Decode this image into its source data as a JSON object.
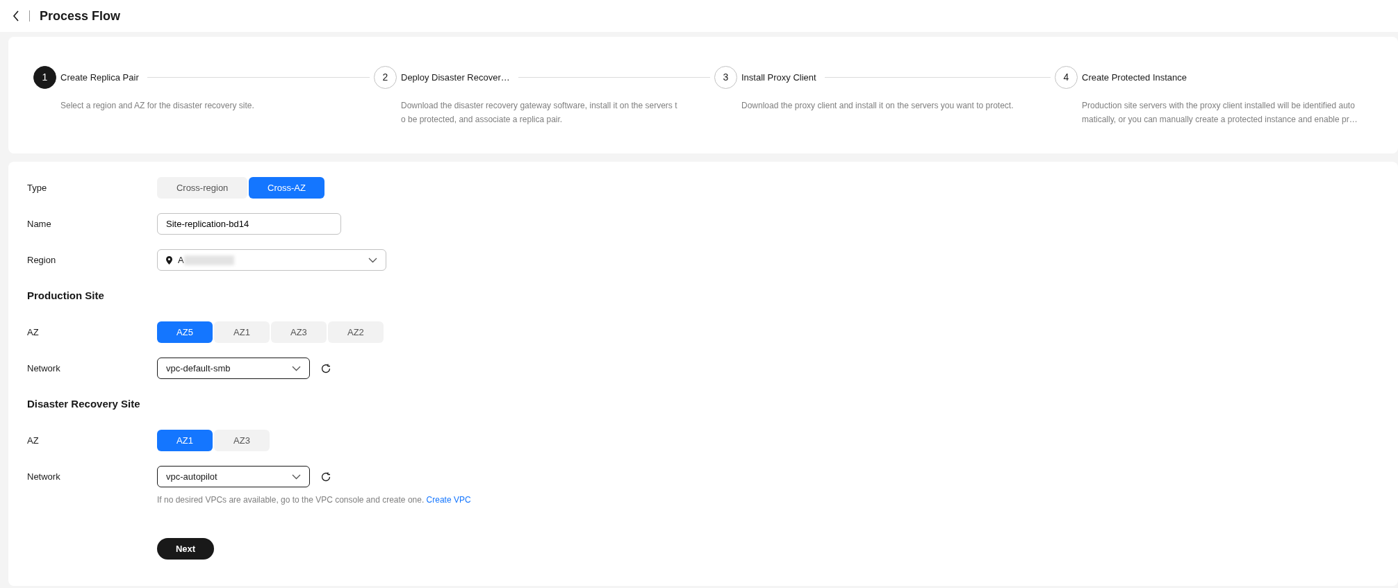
{
  "header": {
    "title": "Process Flow"
  },
  "steps": [
    {
      "number": "1",
      "title": "Create Replica Pair",
      "active": true,
      "description": [
        "Select a region and AZ for the disaster recovery site."
      ]
    },
    {
      "number": "2",
      "title": "Deploy Disaster Recover…",
      "active": false,
      "description": [
        "Download the disaster recovery gateway software, install it on the servers t",
        "o be protected, and associate a replica pair."
      ]
    },
    {
      "number": "3",
      "title": "Install Proxy Client",
      "active": false,
      "description": [
        "Download the proxy client and install it on the servers you want to protect."
      ]
    },
    {
      "number": "4",
      "title": "Create Protected Instance",
      "active": false,
      "description": [
        "Production site servers with the proxy client installed will be identified auto",
        "matically, or you can manually create a protected instance and enable pr…"
      ]
    }
  ],
  "form": [
    {
      "kind": "segments",
      "label": "Type",
      "options": [
        {
          "label": "Cross-region",
          "selected": false
        },
        {
          "label": "Cross-AZ",
          "selected": true
        }
      ]
    },
    {
      "kind": "input",
      "label": "Name",
      "value": "Site-replication-bd14"
    },
    {
      "kind": "region",
      "label": "Region",
      "value": "A"
    },
    {
      "kind": "heading",
      "label": "Production Site"
    },
    {
      "kind": "az",
      "label": "AZ",
      "options": [
        {
          "label": "AZ5",
          "selected": true
        },
        {
          "label": "AZ1",
          "selected": false
        },
        {
          "label": "AZ3",
          "selected": false
        },
        {
          "label": "AZ2",
          "selected": false
        }
      ]
    },
    {
      "kind": "network",
      "label": "Network",
      "value": "vpc-default-smb"
    },
    {
      "kind": "heading",
      "label": "Disaster Recovery Site"
    },
    {
      "kind": "az",
      "label": "AZ",
      "options": [
        {
          "label": "AZ1",
          "selected": true
        },
        {
          "label": "AZ3",
          "selected": false
        }
      ]
    },
    {
      "kind": "network",
      "label": "Network",
      "value": "vpc-autopilot",
      "hint": "If no desired VPCs are available, go to the VPC console and create one.",
      "hint_link": "Create VPC"
    }
  ],
  "next_button": "Next"
}
